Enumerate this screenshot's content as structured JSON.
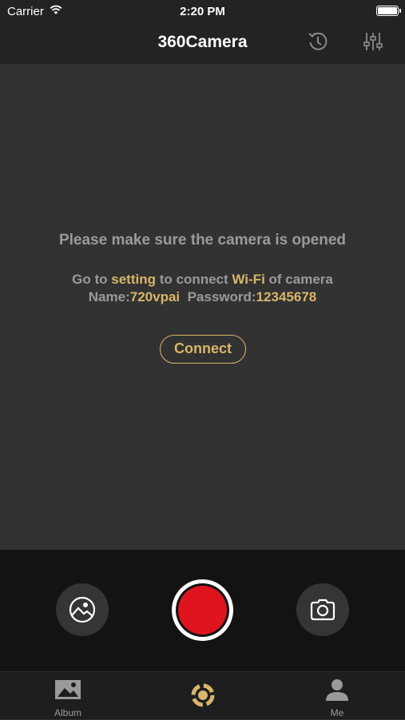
{
  "status_bar": {
    "carrier": "Carrier",
    "time": "2:20 PM"
  },
  "navbar": {
    "title": "360Camera",
    "history_icon": "history-icon",
    "settings_icon": "sliders-icon"
  },
  "message": {
    "main": "Please make sure the camera is opened",
    "line1": {
      "prefix": "Go to ",
      "setting": "setting",
      "middle": " to connect ",
      "wifi": "Wi-Fi",
      "suffix": " of camera"
    },
    "line2": {
      "name_label": "Name:",
      "name_value": "720vpai",
      "password_label": "Password:",
      "password_value": "12345678"
    }
  },
  "connect_label": "Connect",
  "controls": {
    "album_icon": "image-icon",
    "record_icon": "record-icon",
    "photo_icon": "camera-icon"
  },
  "tabs": [
    {
      "label": "Album",
      "icon": "album-icon"
    },
    {
      "label": "",
      "icon": "360-camera-logo-icon"
    },
    {
      "label": "Me",
      "icon": "person-icon"
    }
  ],
  "colors": {
    "accent": "#d9b56a",
    "record": "#e0141e",
    "background": "#323232",
    "bar": "#232323"
  }
}
